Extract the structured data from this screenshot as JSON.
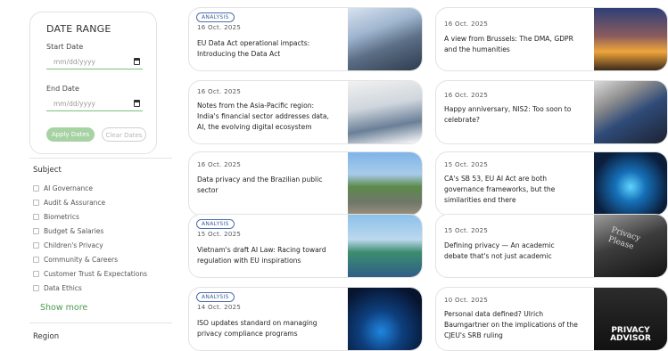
{
  "filters": {
    "date_range_title": "DATE RANGE",
    "start_label": "Start Date",
    "start_placeholder": "mm/dd/yyyy",
    "end_label": "End Date",
    "end_placeholder": "mm/dd/yyyy",
    "apply_label": "Apply Dates",
    "clear_label": "Clear Dates"
  },
  "subject": {
    "title": "Subject",
    "items": [
      "AI Governance",
      "Audit & Assurance",
      "Biometrics",
      "Budget & Salaries",
      "Children's Privacy",
      "Community & Careers",
      "Customer Trust & Expectations",
      "Data Ethics"
    ],
    "show_more": "Show more"
  },
  "region": {
    "title": "Region"
  },
  "articles_left": [
    {
      "badge": "ANALYSIS",
      "date": "16 Oct. 2025",
      "title": "EU Data Act operational impacts: Introducing the Data Act",
      "thumb_icon": "office-building-photo"
    },
    {
      "badge": "",
      "date": "16 Oct. 2025",
      "title": "Notes from the Asia-Pacific region: India's financial sector addresses data, AI, the evolving digital ecosystem",
      "thumb_icon": "newspaper-photo"
    },
    {
      "badge": "",
      "date": "16 Oct. 2025",
      "title": "Data privacy and the Brazilian public sector",
      "thumb_icon": "rio-city-photo"
    },
    {
      "badge": "ANALYSIS",
      "date": "15 Oct. 2025",
      "title": "Vietnam's draft AI Law: Racing toward regulation with EU inspirations",
      "thumb_icon": "vietnam-bridge-photo"
    },
    {
      "badge": "ANALYSIS",
      "date": "14 Oct. 2025",
      "title": "ISO updates standard on managing privacy compliance programs",
      "thumb_icon": "digital-network-photo"
    }
  ],
  "articles_right": [
    {
      "date": "16 Oct. 2025",
      "title": "A view from Brussels: The DMA, GDPR and the humanities",
      "thumb_icon": "brussels-night-photo"
    },
    {
      "date": "16 Oct. 2025",
      "title": "Happy anniversary, NIS2: Too soon to celebrate?",
      "thumb_icon": "smartphone-photo"
    },
    {
      "date": "15 Oct. 2025",
      "title": "CA's SB 53, EU AI Act are both governance frameworks, but the similarities end there",
      "thumb_icon": "ai-chip-photo"
    },
    {
      "date": "15 Oct. 2025",
      "title": "Defining privacy — An academic debate that's not just academic",
      "thumb_icon": "privacy-please-sign-photo",
      "thumb_text": "Privacy Please"
    },
    {
      "date": "10 Oct. 2025",
      "title": "Personal data defined? Ulrich Baumgartner on the implications of the CJEU's SRB ruling",
      "thumb_icon": "privacy-advisor-podcast-logo",
      "thumb_text": "PRIVACY ADVISOR"
    }
  ],
  "colors": {
    "accent_green": "#4d9a4f",
    "badge_blue": "#3f5e98"
  }
}
